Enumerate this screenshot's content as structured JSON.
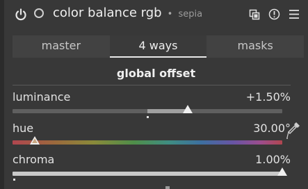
{
  "header": {
    "title": "color balance rgb",
    "separator": "•",
    "instance": "sepia"
  },
  "tabs": [
    {
      "label": "master",
      "active": false
    },
    {
      "label": "4 ways",
      "active": true
    },
    {
      "label": "masks",
      "active": false
    }
  ],
  "section": {
    "title": "global offset"
  },
  "sliders": {
    "luminance": {
      "label": "luminance",
      "value": "+1.50%",
      "position": 0.65
    },
    "hue": {
      "label": "hue",
      "value": "30.00°",
      "position": 0.083
    },
    "chroma": {
      "label": "chroma",
      "value": "1.00%",
      "position": 1.0
    }
  },
  "icons": {
    "power": "power-icon",
    "preset": "preset-circle-icon",
    "multi_instance": "multi-instance-icon",
    "reset": "reset-icon",
    "presets_menu": "hamburger-menu-icon",
    "picker": "color-picker-icon"
  },
  "colors": {
    "background": "#383838",
    "text": "#e6e6e6",
    "accent": "#f0f0f0"
  }
}
